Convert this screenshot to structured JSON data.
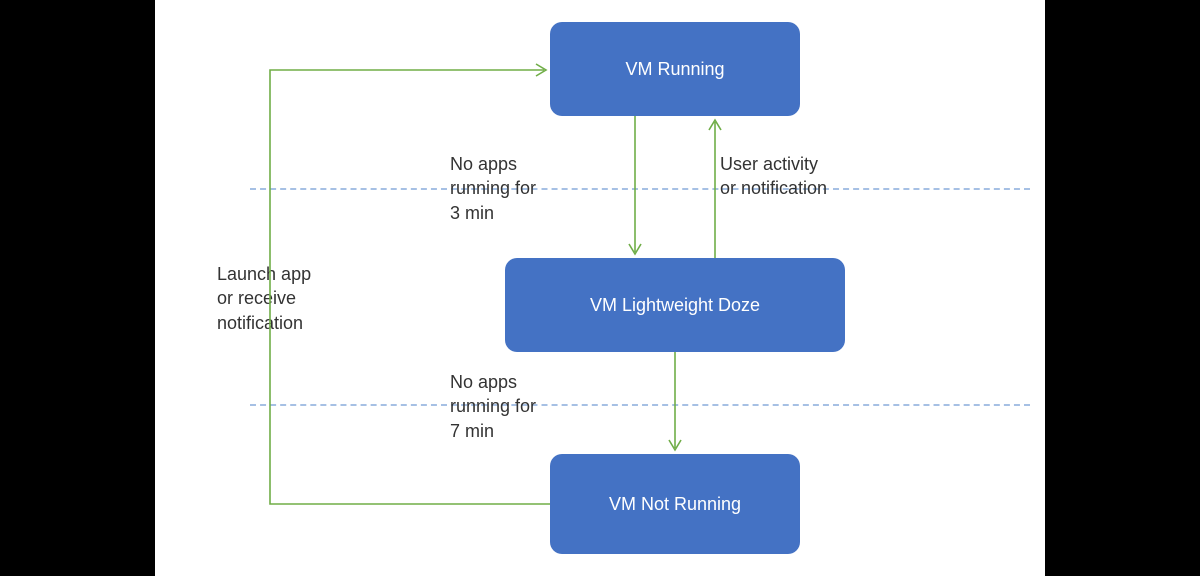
{
  "diagram": {
    "states": {
      "running": "VM Running",
      "doze": "VM Lightweight Doze",
      "not_running": "VM Not Running"
    },
    "transitions": {
      "running_to_doze": "No apps\nrunning for\n3 min",
      "doze_to_running": "User activity\nor notification",
      "doze_to_not_running": "No apps\nrunning for\n7 min",
      "not_running_to_running": "Launch app\nor receive\nnotification"
    }
  },
  "colors": {
    "state_fill": "#4472C4",
    "arrow": "#70AD47",
    "divider": "#A6C0E4"
  }
}
